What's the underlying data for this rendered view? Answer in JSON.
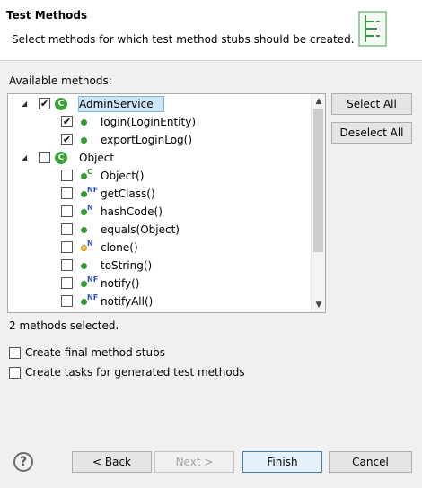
{
  "header": {
    "title": "Test Methods",
    "description": "Select methods for which test method stubs should be created."
  },
  "available_label": "Available methods:",
  "tree": [
    {
      "label": "AdminService",
      "level": 0,
      "checked": true,
      "expanded": true,
      "icon": "class-icon",
      "selected": true
    },
    {
      "label": "login(LoginEntity)",
      "level": 1,
      "checked": true,
      "icon": "public-method-icon",
      "badge": ""
    },
    {
      "label": "exportLoginLog()",
      "level": 1,
      "checked": true,
      "icon": "public-method-icon",
      "badge": ""
    },
    {
      "label": "Object",
      "level": 0,
      "checked": false,
      "expanded": true,
      "icon": "class-icon"
    },
    {
      "label": "Object()",
      "level": 1,
      "checked": false,
      "icon": "public-method-icon",
      "badge": "C"
    },
    {
      "label": "getClass()",
      "level": 1,
      "checked": false,
      "icon": "public-method-icon",
      "badge": "NF"
    },
    {
      "label": "hashCode()",
      "level": 1,
      "checked": false,
      "icon": "public-method-icon",
      "badge": "N"
    },
    {
      "label": "equals(Object)",
      "level": 1,
      "checked": false,
      "icon": "public-method-icon",
      "badge": ""
    },
    {
      "label": "clone()",
      "level": 1,
      "checked": false,
      "icon": "protected-method-icon",
      "badge": "N"
    },
    {
      "label": "toString()",
      "level": 1,
      "checked": false,
      "icon": "public-method-icon",
      "badge": ""
    },
    {
      "label": "notify()",
      "level": 1,
      "checked": false,
      "icon": "public-method-icon",
      "badge": "NF"
    },
    {
      "label": "notifyAll()",
      "level": 1,
      "checked": false,
      "icon": "public-method-icon",
      "badge": "NF"
    }
  ],
  "class_icon_glyph": "C",
  "buttons": {
    "select_all": "Select All",
    "deselect_all": "Deselect All",
    "back": "< Back",
    "next": "Next >",
    "finish": "Finish",
    "cancel": "Cancel",
    "help": "?"
  },
  "status": "2 methods selected.",
  "options": {
    "final_stubs": {
      "label": "Create final method stubs",
      "checked": false
    },
    "tasks": {
      "label": "Create tasks for generated test methods",
      "checked": false
    }
  },
  "colors": {
    "accent": "#3c7fb1",
    "selection": "#cce6f8",
    "method_green": "#2f9a2f",
    "protected_yellow": "#f3c94a"
  }
}
